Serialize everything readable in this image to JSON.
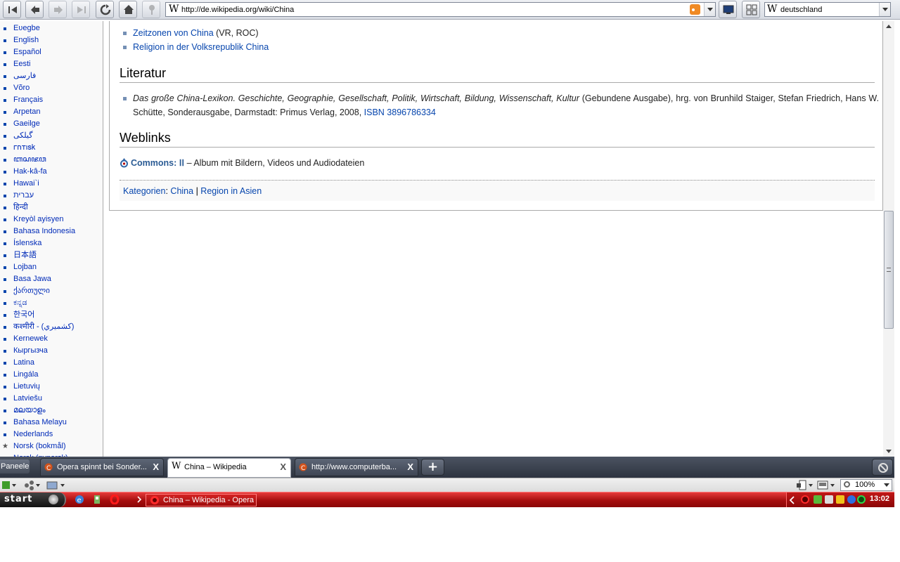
{
  "toolbar": {
    "address": "http://de.wikipedia.org/wiki/China",
    "search_engine_logo": "W",
    "search_value": "deutschland",
    "address_logo": "W"
  },
  "sidebar": {
    "languages": [
      "Eʋegbe",
      "English",
      "Español",
      "Eesti",
      "فارسی",
      "Võro",
      "Français",
      "Arpetan",
      "Gaeilge",
      "گیلکی",
      "𐌲𐌿𐍄𐌹𐍃𐌺",
      "ꦧꦱꦗꦮ",
      "Hak-kâ-fa",
      "Hawai`i",
      "עברית",
      "हिन्दी",
      "Kreyòl ayisyen",
      "Bahasa Indonesia",
      "Íslenska",
      "日本語",
      "Lojban",
      "Basa Jawa",
      "ქართული",
      "ಕನ್ನಡ",
      "한국어",
      "कश्मीरी - (كشميري)",
      "Kernewek",
      "Кыргызча",
      "Latina",
      "Lingála",
      "Lietuvių",
      "Latviešu",
      "മലയാളം",
      "Bahasa Melayu",
      "Nederlands",
      "Norsk (bokmål)",
      "Norsk (nynorsk)"
    ]
  },
  "content": {
    "top_items": [
      {
        "link": "Zeitzonen von China",
        "rest": " (VR, ROC)"
      },
      {
        "link": "Religion in der Volksrepublik China",
        "rest": ""
      }
    ],
    "heading_literatur": "Literatur",
    "lit_italic": "Das große China-Lexikon. Geschichte, Geographie, Gesellschaft, Politik, Wirtschaft, Bildung, Wissenschaft, Kultur",
    "lit_rest": " (Gebundene Ausgabe), hrg. von Brunhild Staiger, Stefan Friedrich, Hans W. Schütte, Sonderausgabe, Darmstadt: Primus Verlag, 2008, ",
    "lit_isbn": "ISBN 3896786334",
    "heading_weblinks": "Weblinks",
    "commons_label": "Commons: ⅠⅠ",
    "commons_rest": " – Album mit Bildern, Videos und Audiodateien",
    "cat_label": "Kategorien",
    "cat_colon": ": ",
    "cat_1": "China",
    "cat_sep": " | ",
    "cat_2": "Region in Asien"
  },
  "tabs": {
    "panels_label": "Paneele",
    "items": [
      {
        "title": "Opera spinnt bei Sonder...",
        "active": false
      },
      {
        "title": "China – Wikipedia",
        "active": true
      },
      {
        "title": "http://www.computerba...",
        "active": false
      }
    ],
    "close_glyph": "X",
    "new_tab_glyph": "+"
  },
  "statusbar": {
    "zoom": "100%"
  },
  "taskbar": {
    "start_label": "start",
    "window_title": "China – Wikipedia - Opera",
    "clock": "13:02"
  },
  "colors": {
    "link": "#0645ad",
    "taskbar_red": "#a60e0e",
    "tabbar_dark": "#2e3440"
  }
}
